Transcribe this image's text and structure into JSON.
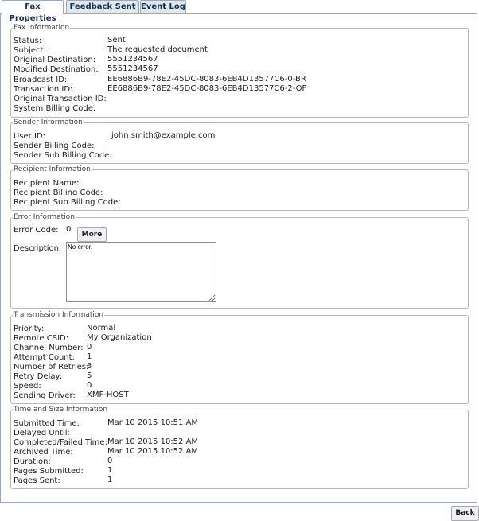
{
  "tabs": [
    {
      "label": "Fax Properties",
      "active": true
    },
    {
      "label": "Feedback Sent To",
      "active": false
    },
    {
      "label": "Event Log",
      "active": false
    }
  ],
  "fax_info": {
    "legend": "Fax Information",
    "status_label": "Status:",
    "status": "Sent",
    "subject_label": "Subject:",
    "subject": "The requested document",
    "orig_dest_label": "Original Destination:",
    "orig_dest": "5551234567",
    "mod_dest_label": "Modified Destination:",
    "mod_dest": "5551234567",
    "broadcast_label": "Broadcast ID:",
    "broadcast": "EE6886B9-78E2-45DC-8083-6EB4D13577C6-0-BR",
    "transaction_label": "Transaction ID:",
    "transaction": "EE6886B9-78E2-45DC-8083-6EB4D13577C6-2-OF",
    "orig_trans_label": "Original Transaction ID:",
    "billing_label": "System Billing Code:"
  },
  "sender_info": {
    "legend": "Sender Information",
    "user_label": "User ID:",
    "user": "john.smith@example.com",
    "billing_label": "Sender Billing Code:",
    "sub_billing_label": "Sender Sub Billing Code:"
  },
  "recipient_info": {
    "legend": "Recipient Information",
    "name_label": "Recipient Name:",
    "billing_label": "Recipient Billing Code:",
    "sub_billing_label": "Recipient Sub Billing Code:"
  },
  "error_info": {
    "legend": "Error Information",
    "code_label": "Error Code:",
    "code": "0",
    "more_button": "More",
    "desc_label": "Description:",
    "desc": "No error."
  },
  "transmission_info": {
    "legend": "Transmission Information",
    "priority_label": "Priority:",
    "priority": "Normal",
    "csid_label": "Remote CSID:",
    "csid": "My Organization",
    "channel_label": "Channel Number:",
    "channel": "0",
    "attempt_label": "Attempt Count:",
    "attempt": "1",
    "retries_label": "Number of Retries:",
    "retries": "3",
    "delay_label": "Retry Delay:",
    "delay": "5",
    "speed_label": "Speed:",
    "speed": "0",
    "driver_label": "Sending Driver:",
    "driver": "XMF-HOST"
  },
  "time_info": {
    "legend": "Time and Size Information",
    "submitted_label": "Submitted Time:",
    "submitted": "Mar 10 2015 10:51 AM",
    "delayed_label": "Delayed Until:",
    "completed_label": "Completed/Failed Time:",
    "completed": "Mar 10 2015 10:52 AM",
    "archived_label": "Archived Time:",
    "archived": "Mar 10 2015 10:52 AM",
    "duration_label": "Duration:",
    "duration": "0",
    "pages_submitted_label": "Pages Submitted:",
    "pages_submitted": "1",
    "pages_sent_label": "Pages Sent:",
    "pages_sent": "1"
  },
  "back_button": "Back"
}
